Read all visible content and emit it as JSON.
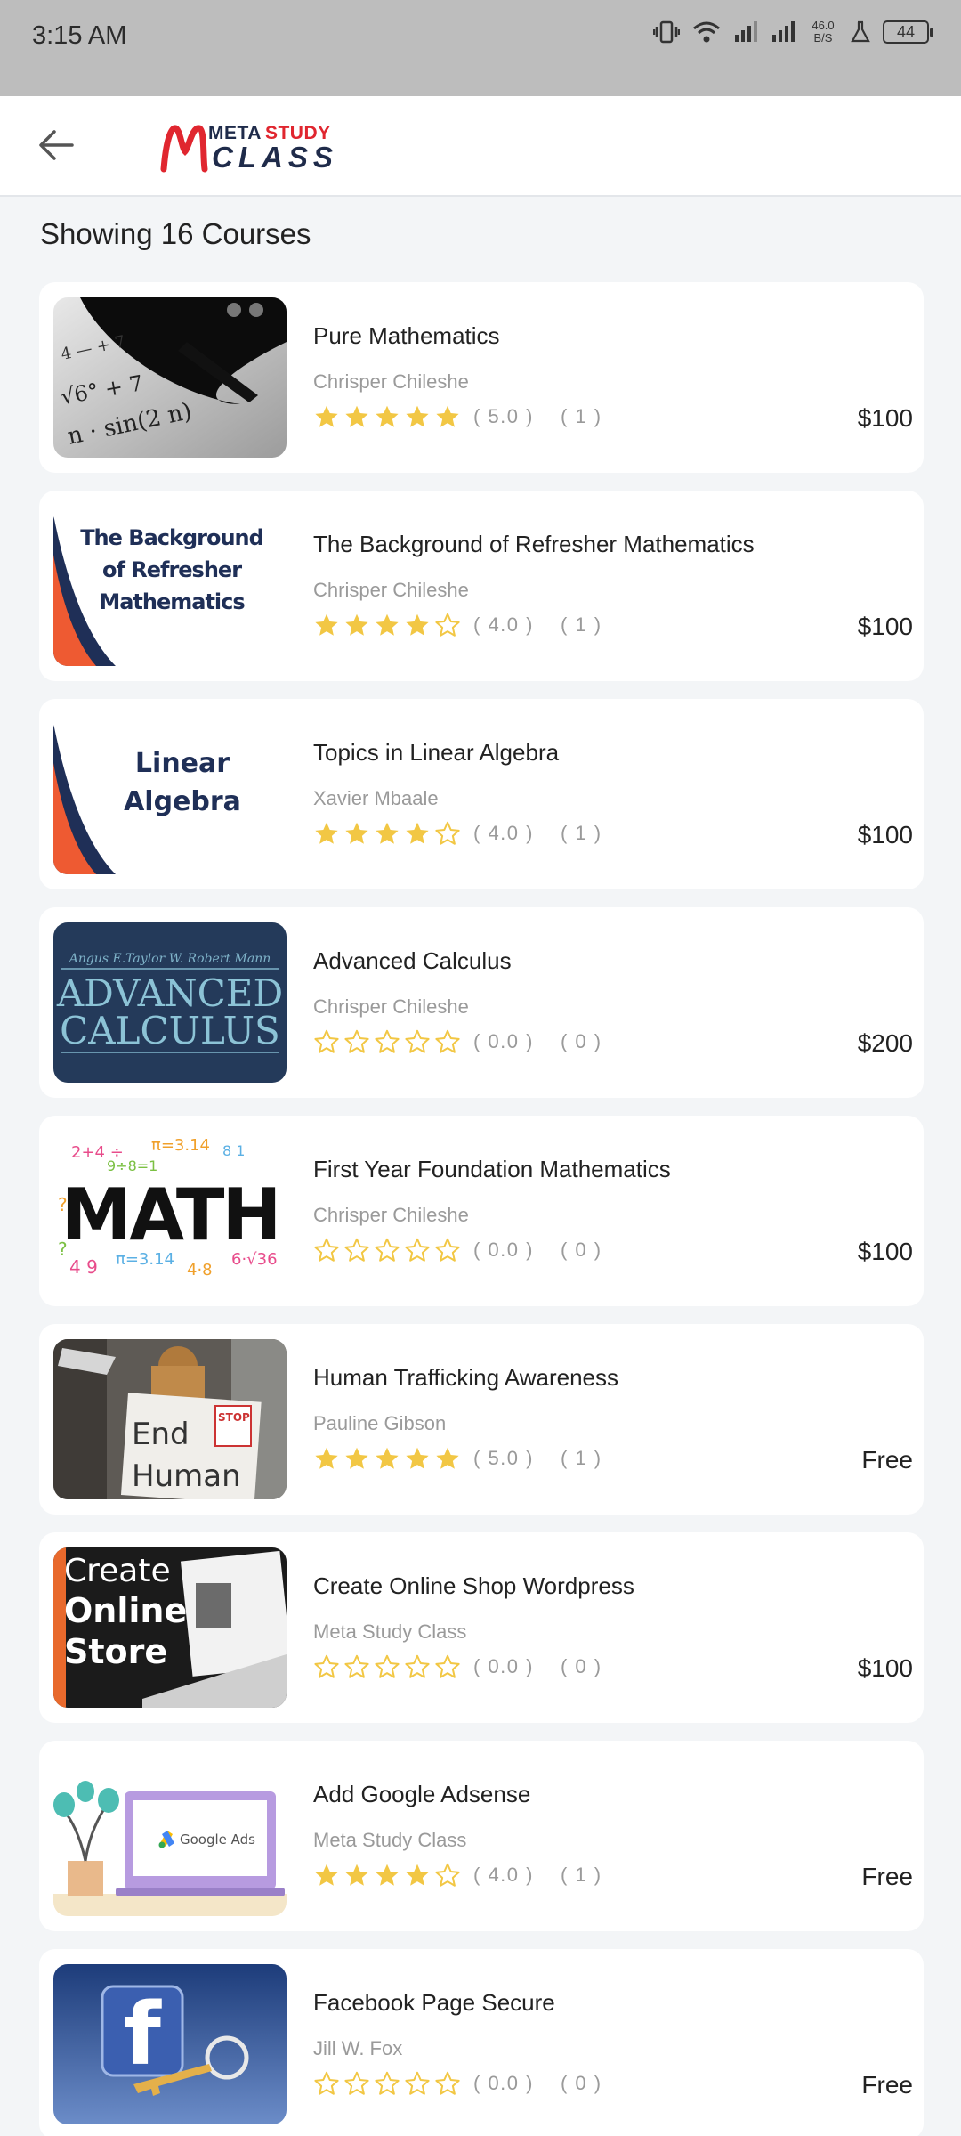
{
  "status_bar": {
    "time": "3:15 AM",
    "net_speed_value": "46.0",
    "net_speed_unit": "B/S",
    "battery": "44"
  },
  "header": {
    "logo_top_1": "META",
    "logo_top_2": "STUDY",
    "logo_bottom": "CLASS"
  },
  "page": {
    "showing_label": "Showing 16 Courses"
  },
  "colors": {
    "star": "#f2c744",
    "star_empty_stroke": "#f2c744",
    "accent_red": "#e0262f",
    "brand_navy": "#1f2b4a"
  },
  "thumb_texts": {
    "refresher": [
      "The Background",
      "of Refresher",
      "Mathematics"
    ],
    "linear": [
      "Linear",
      "Algebra"
    ],
    "calc_authors": "Angus E.Taylor   W. Robert Mann",
    "calc_1": "ADVANCED",
    "calc_2": "CALCULUS",
    "math": "MATH",
    "human_1": "End",
    "human_2": "Human",
    "human_stop": "STOP",
    "shop_1": "Create",
    "shop_2": "Online",
    "shop_3": "Store",
    "google_ads": "Google Ads",
    "facebook": "f"
  },
  "courses": [
    {
      "title": "Pure Mathematics",
      "author": "Chrisper Chileshe",
      "rating": 5,
      "score": "( 5.0 )",
      "count": "( 1 )",
      "price": "$100",
      "thumb": "pure"
    },
    {
      "title": "The Background of Refresher Mathematics",
      "author": "Chrisper Chileshe",
      "rating": 4,
      "score": "( 4.0 )",
      "count": "( 1 )",
      "price": "$100",
      "thumb": "refresher"
    },
    {
      "title": "Topics in Linear Algebra",
      "author": "Xavier Mbaale",
      "rating": 4,
      "score": "( 4.0 )",
      "count": "( 1 )",
      "price": "$100",
      "thumb": "linear"
    },
    {
      "title": "Advanced Calculus",
      "author": "Chrisper Chileshe",
      "rating": 0,
      "score": "( 0.0 )",
      "count": "( 0 )",
      "price": "$200",
      "thumb": "calculus"
    },
    {
      "title": "First Year Foundation Mathematics",
      "author": "Chrisper Chileshe",
      "rating": 0,
      "score": "( 0.0 )",
      "count": "( 0 )",
      "price": "$100",
      "thumb": "math"
    },
    {
      "title": "Human Trafficking Awareness",
      "author": "Pauline Gibson",
      "rating": 5,
      "score": "( 5.0 )",
      "count": "( 1 )",
      "price": "Free",
      "thumb": "human"
    },
    {
      "title": "Create Online Shop Wordpress",
      "author": "Meta Study Class",
      "rating": 0,
      "score": "( 0.0 )",
      "count": "( 0 )",
      "price": "$100",
      "thumb": "shop"
    },
    {
      "title": "Add Google Adsense",
      "author": "Meta Study Class",
      "rating": 4,
      "score": "( 4.0 )",
      "count": "( 1 )",
      "price": "Free",
      "thumb": "adsense"
    },
    {
      "title": "Facebook Page Secure",
      "author": "Jill W. Fox",
      "rating": 0,
      "score": "( 0.0 )",
      "count": "( 0 )",
      "price": "Free",
      "thumb": "facebook"
    }
  ]
}
